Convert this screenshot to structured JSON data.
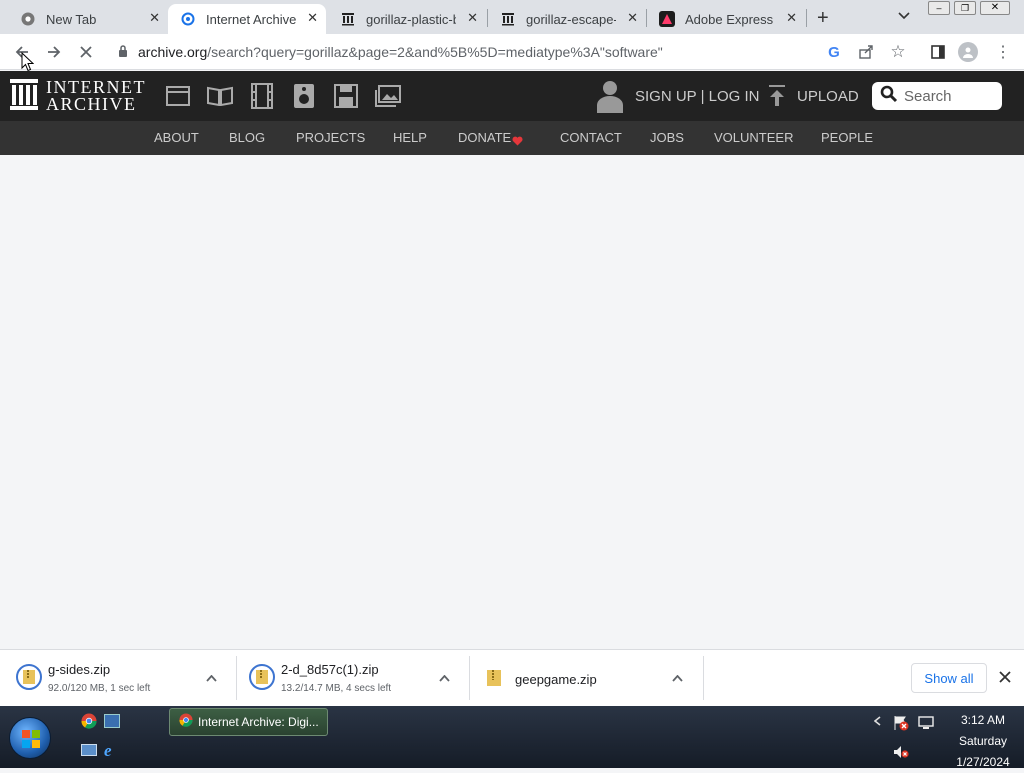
{
  "browser": {
    "tabs": [
      {
        "title": "New Tab",
        "active": false
      },
      {
        "title": "Internet Archive: D",
        "active": true
      },
      {
        "title": "gorillaz-plastic-be",
        "active": false
      },
      {
        "title": "gorillaz-escape-fr",
        "active": false
      },
      {
        "title": "Adobe Express",
        "active": false
      }
    ],
    "url_domain": "archive.org",
    "url_path": "/search?query=gorillaz&page=2&and%5B%5D=mediatype%3A\"software\""
  },
  "ia": {
    "logo_line1": "INTERNET",
    "logo_line2": "ARCHIVE",
    "signup": "SIGN UP | LOG IN",
    "upload": "UPLOAD",
    "search_placeholder": "Search",
    "nav": [
      "ABOUT",
      "BLOG",
      "PROJECTS",
      "HELP",
      "DONATE",
      "CONTACT",
      "JOBS",
      "VOLUNTEER",
      "PEOPLE"
    ],
    "donate_heart_color": "#e5373b"
  },
  "downloads": {
    "items": [
      {
        "name": "g-sides.zip",
        "status": "92.0/120 MB, 1 sec left"
      },
      {
        "name": "2-d_8d57c(1).zip",
        "status": "13.2/14.7 MB, 4 secs left"
      },
      {
        "name": "geepgame.zip",
        "status": ""
      }
    ],
    "show_all": "Show all"
  },
  "taskbar": {
    "active_window": "Internet Archive: Digi...",
    "time": "3:12 AM",
    "day": "Saturday",
    "date": "1/27/2024"
  }
}
